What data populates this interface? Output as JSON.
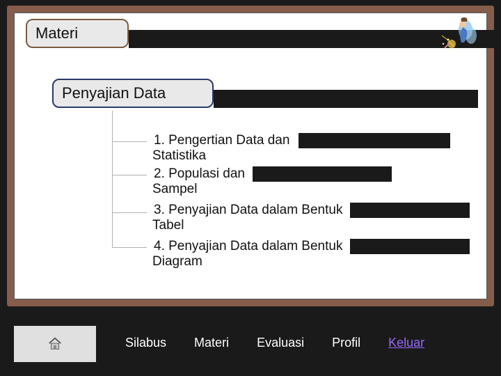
{
  "title": "Materi",
  "heading": "Penyajian Data",
  "items": [
    {
      "line1": "1. Pengertian Data dan",
      "line2": "Statistika"
    },
    {
      "line1": "2. Populasi dan",
      "line2": "Sampel"
    },
    {
      "line1": "3. Penyajian Data dalam Bentuk",
      "line2": "Tabel"
    },
    {
      "line1": "4. Penyajian Data dalam Bentuk",
      "line2": "Diagram"
    }
  ],
  "nav": {
    "silabus": "Silabus",
    "materi": "Materi",
    "evaluasi": "Evaluasi",
    "profil": "Profil",
    "keluar": "Keluar"
  }
}
